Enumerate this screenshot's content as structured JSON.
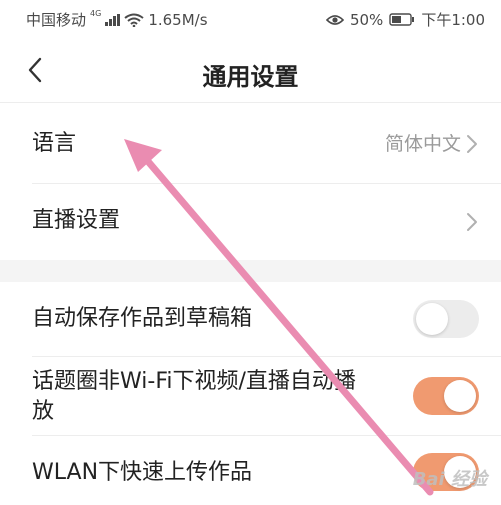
{
  "status_bar": {
    "carrier": "中国移动",
    "network_badge": "4G",
    "speed": "1.65M/s",
    "battery": "50%",
    "time": "下午1:00"
  },
  "header": {
    "title": "通用设置"
  },
  "settings": {
    "language": {
      "label": "语言",
      "value": "简体中文"
    },
    "live": {
      "label": "直播设置"
    },
    "auto_save": {
      "label": "自动保存作品到草稿箱",
      "enabled": false
    },
    "autoplay": {
      "label_line1": "话题圈非Wi-Fi下视频/直播自动播",
      "label_line2": "放",
      "enabled": true
    },
    "wlan_upload": {
      "label": "WLAN下快速上传作品",
      "enabled": true
    }
  },
  "colors": {
    "toggle_on": "#f09a70",
    "toggle_off": "#ececec",
    "annotation": "#ea8cb1"
  },
  "watermark": "Bai 经验"
}
